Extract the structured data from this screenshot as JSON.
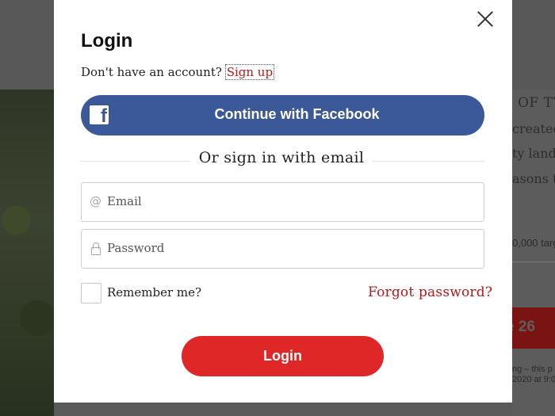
{
  "background": {
    "article_lines": [
      "OF TV",
      "created",
      "ty land",
      "asons th"
    ],
    "target_text": "0,000 targ",
    "cta_label": "e 26",
    "footnote_lines": [
      "ng – this p",
      "2020 at 9:0"
    ]
  },
  "modal": {
    "title": "Login",
    "signup_prompt": "Don't have an account?",
    "signup_link": "Sign up",
    "facebook_button": "Continue with Facebook",
    "divider_text": "Or sign in with email",
    "email": {
      "placeholder": "Email",
      "value": ""
    },
    "password": {
      "placeholder": "Password",
      "value": ""
    },
    "remember_label": "Remember me?",
    "remember_checked": false,
    "forgot_link": "Forgot password?",
    "login_button": "Login"
  },
  "colors": {
    "facebook": "#3b5998",
    "accent_red": "#e02727",
    "link_red": "#b01c1c"
  }
}
